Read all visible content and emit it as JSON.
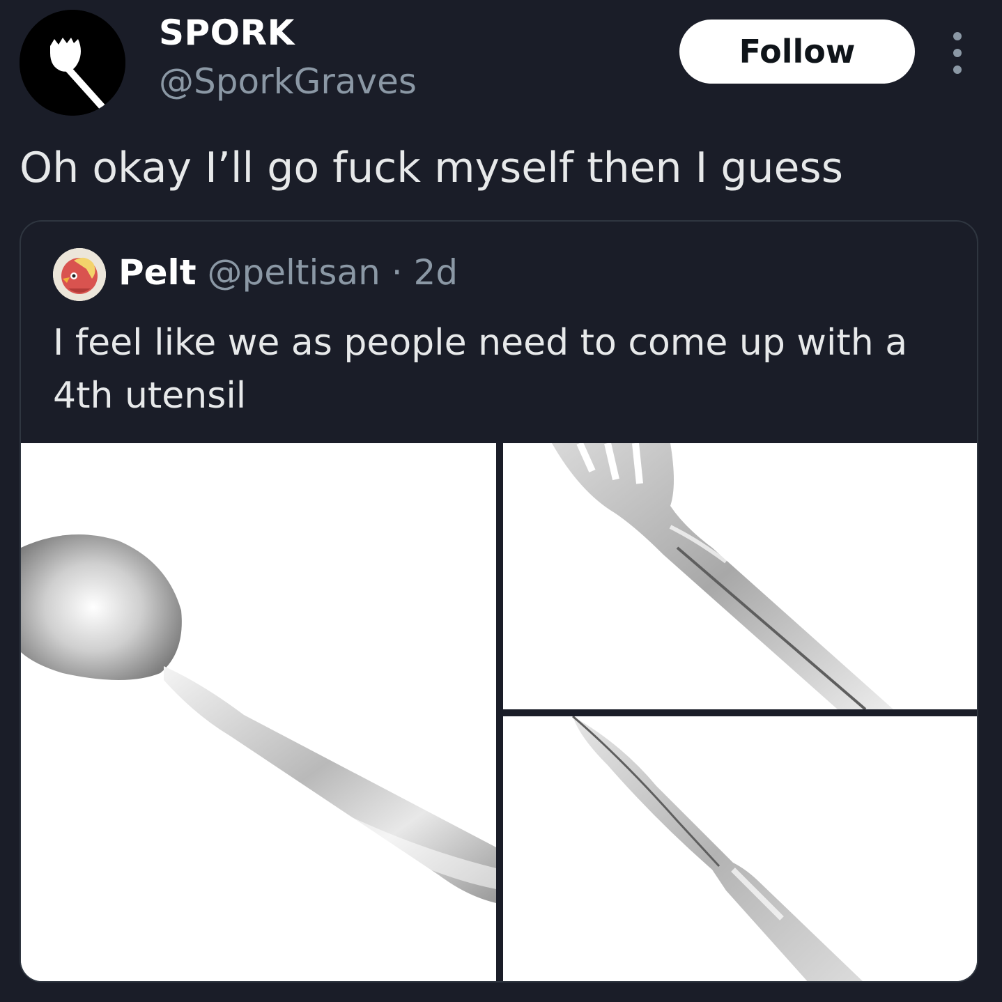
{
  "author": {
    "display_name": "SPORK",
    "handle": "@SporkGraves",
    "avatar_icon": "spork-icon"
  },
  "follow_label": "Follow",
  "more_icon": "more-options-icon",
  "tweet_text": "Oh okay I’ll go fuck myself then I guess",
  "quote": {
    "display_name": "Pelt",
    "handle": "@peltisan",
    "separator": "·",
    "time": "2d",
    "text": "I feel like we as people need to come up with a 4th utensil",
    "images": [
      "spoon",
      "fork",
      "knife"
    ]
  },
  "colors": {
    "background": "#1a1d28",
    "secondary_text": "#8b98a5",
    "follow_button": "#ffffff"
  }
}
